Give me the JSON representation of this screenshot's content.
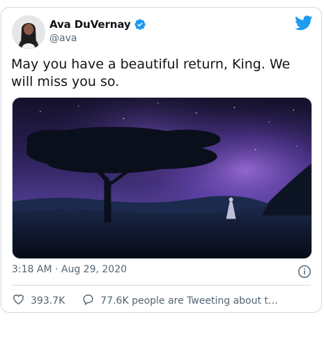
{
  "tweet": {
    "author": {
      "display_name": "Ava DuVernay",
      "handle": "@ava",
      "verified": true,
      "avatar": "avatar-photo"
    },
    "text": "May you have a beautiful return, King. We will miss you so.",
    "media": {
      "type": "image",
      "description_icon": "night-savanna-tree-image"
    },
    "timestamp": "3:18 AM · Aug 29, 2020",
    "likes_count": "393.7K",
    "reply_label": "77.6K people are Tweeting about t…"
  },
  "icons": {
    "brand": "twitter-bird-icon",
    "info": "info-icon",
    "like": "heart-icon",
    "reply": "speech-bubble-icon",
    "verified": "verified-badge-icon"
  },
  "colors": {
    "brand": "#1d9bf0",
    "text_primary": "#0f1419",
    "text_secondary": "#536471",
    "border": "#cfd9de"
  }
}
